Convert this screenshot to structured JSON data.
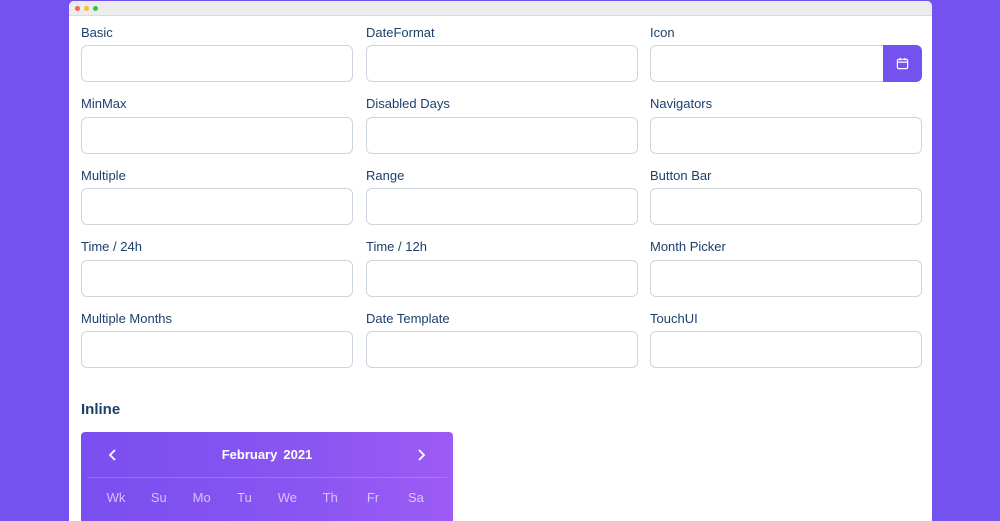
{
  "fields": [
    {
      "label": "Basic",
      "value": ""
    },
    {
      "label": "DateFormat",
      "value": ""
    },
    {
      "label": "Icon",
      "value": ""
    },
    {
      "label": "MinMax",
      "value": ""
    },
    {
      "label": "Disabled Days",
      "value": ""
    },
    {
      "label": "Navigators",
      "value": ""
    },
    {
      "label": "Multiple",
      "value": ""
    },
    {
      "label": "Range",
      "value": ""
    },
    {
      "label": "Button Bar",
      "value": ""
    },
    {
      "label": "Time / 24h",
      "value": ""
    },
    {
      "label": "Time / 12h",
      "value": ""
    },
    {
      "label": "Month Picker",
      "value": ""
    },
    {
      "label": "Multiple Months",
      "value": ""
    },
    {
      "label": "Date Template",
      "value": ""
    },
    {
      "label": "TouchUI",
      "value": ""
    }
  ],
  "icon_button": {
    "icon": "calendar-icon"
  },
  "inline": {
    "title": "Inline",
    "calendar": {
      "month": "February",
      "year": "2021",
      "prev_icon": "chevron-left-icon",
      "next_icon": "chevron-right-icon",
      "weekdays": [
        "Wk",
        "Su",
        "Mo",
        "Tu",
        "We",
        "Th",
        "Fr",
        "Sa"
      ]
    }
  },
  "colors": {
    "background": "#7352f0",
    "accent": "#7452f0",
    "label": "#1c3f6b",
    "input_border": "#cfd5dc"
  }
}
